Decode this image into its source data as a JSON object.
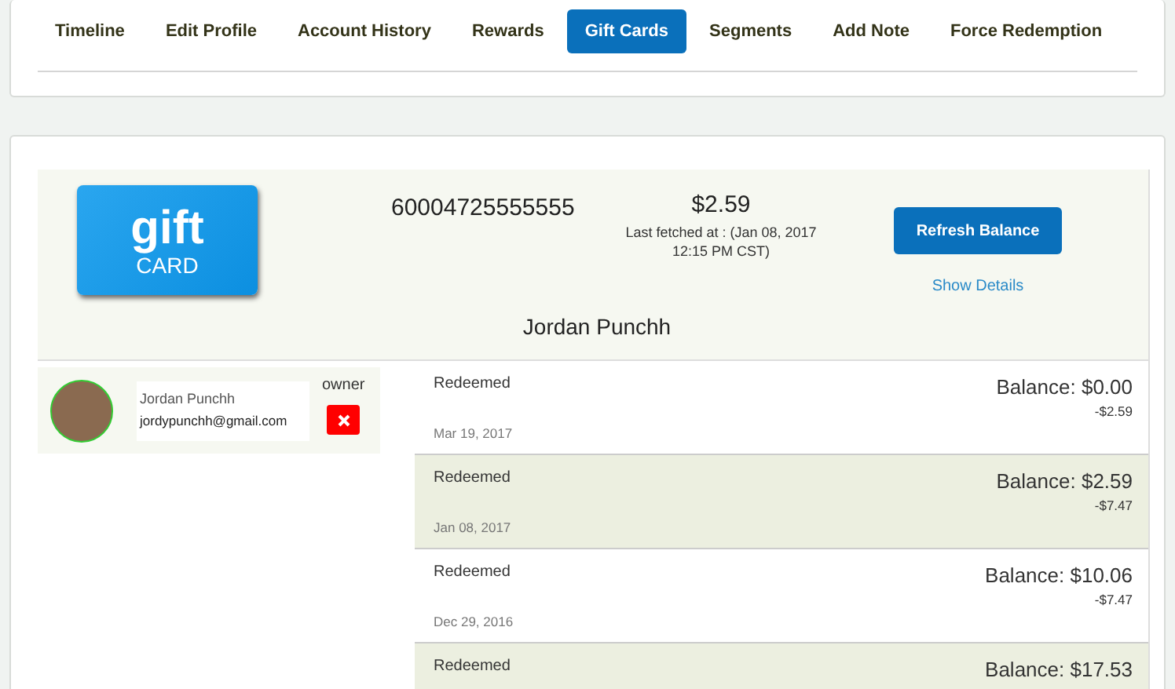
{
  "tabs": [
    {
      "label": "Timeline",
      "selected": false
    },
    {
      "label": "Edit Profile",
      "selected": false
    },
    {
      "label": "Account History",
      "selected": false
    },
    {
      "label": "Rewards",
      "selected": false
    },
    {
      "label": "Gift Cards",
      "selected": true
    },
    {
      "label": "Segments",
      "selected": false
    },
    {
      "label": "Add Note",
      "selected": false
    },
    {
      "label": "Force Redemption",
      "selected": false
    }
  ],
  "gift_card": {
    "logo_word": "gift",
    "logo_sub": "CARD",
    "number": "60004725555555",
    "balance": "$2.59",
    "last_fetched": "Last fetched at : (Jan 08, 2017 12:15 PM CST)",
    "refresh_button": "Refresh Balance",
    "details_link": "Show Details",
    "holder": "Jordan Punchh"
  },
  "owner": {
    "name": "Jordan Punchh",
    "email": "jordypunchh@gmail.com",
    "role": "owner"
  },
  "transactions": [
    {
      "type": "Redeemed",
      "date": "Mar 19, 2017",
      "balance": "Balance: $0.00",
      "amount": "-$2.59"
    },
    {
      "type": "Redeemed",
      "date": "Jan 08, 2017",
      "balance": "Balance: $2.59",
      "amount": "-$7.47"
    },
    {
      "type": "Redeemed",
      "date": "Dec 29, 2016",
      "balance": "Balance: $10.06",
      "amount": "-$7.47"
    },
    {
      "type": "Redeemed",
      "balance": "Balance: $17.53"
    }
  ]
}
